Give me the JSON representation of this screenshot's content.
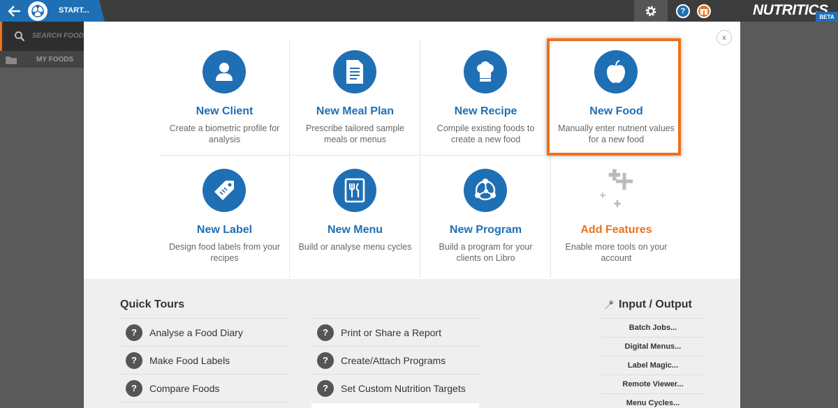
{
  "topbar": {
    "start_label": "START...",
    "brand": "NUTRITICS",
    "beta": "BETA",
    "help": "?"
  },
  "background": {
    "search_placeholder": "SEARCH FOODS",
    "my_foods": "MY FOODS"
  },
  "modal": {
    "close": "x",
    "tiles": [
      {
        "title": "New Client",
        "desc": "Create a biometric profile for analysis",
        "icon": "user-icon"
      },
      {
        "title": "New Meal Plan",
        "desc": "Prescribe tailored sample meals or menus",
        "icon": "document-icon"
      },
      {
        "title": "New Recipe",
        "desc": "Compile existing foods to create a new food",
        "icon": "chef-hat-icon"
      },
      {
        "title": "New Food",
        "desc": "Manually enter nutrient values for a new food",
        "icon": "apple-icon"
      },
      {
        "title": "New Label",
        "desc": "Design food labels from your recipes",
        "icon": "tag-icon"
      },
      {
        "title": "New Menu",
        "desc": "Build or analyse menu cycles",
        "icon": "menu-icon"
      },
      {
        "title": "New Program",
        "desc": "Build a program for your clients on Libro",
        "icon": "network-icon"
      },
      {
        "title": "Add Features",
        "desc": "Enable more tools on your account",
        "icon": "plus-icon"
      }
    ]
  },
  "quick_tours": {
    "title": "Quick Tours",
    "col1": [
      "Analyse a Food Diary",
      "Make Food Labels",
      "Compare Foods"
    ],
    "col2": [
      "Print or Share a Report",
      "Create/Attach Programs",
      "Set Custom Nutrition Targets"
    ]
  },
  "io": {
    "title": "Input / Output",
    "items": [
      "Batch Jobs...",
      "Digital Menus...",
      "Label Magic...",
      "Remote Viewer...",
      "Menu Cycles..."
    ]
  },
  "colors": {
    "primary": "#1f6fb5",
    "accent": "#e8741e",
    "highlight": "#f07018"
  }
}
